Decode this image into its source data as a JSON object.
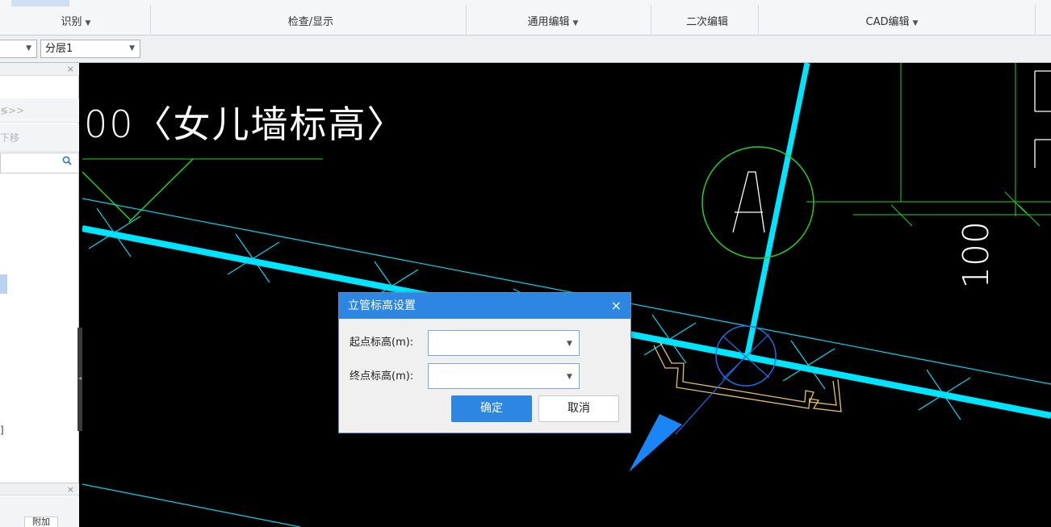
{
  "ribbon": {
    "groups": [
      {
        "label": "识别",
        "has_menu": true
      },
      {
        "label": "检查/显示",
        "has_menu": false
      },
      {
        "label": "通用编辑",
        "has_menu": true
      },
      {
        "label": "二次编辑",
        "has_menu": false
      },
      {
        "label": "CAD编辑",
        "has_menu": true
      }
    ]
  },
  "layer_bar": {
    "floor_combo_value": "",
    "layer_combo_value": "分层1"
  },
  "left_panel": {
    "row1_text": "≶>>",
    "row2_text": "下移",
    "bottom_button": "附加",
    "fragment_text": "]"
  },
  "canvas": {
    "annotation_text": "00〈女儿墙标高〉",
    "axis_label": "A",
    "vertical_dimension": "100"
  },
  "dialog": {
    "title": "立管标高设置",
    "close_glyph": "×",
    "start_label": "起点标高(m):",
    "start_value": "",
    "end_label": "终点标高(m):",
    "end_value": "",
    "ok_label": "确定",
    "cancel_label": "取消"
  },
  "colors": {
    "accent": "#2d86e2",
    "cad_background": "#000000",
    "pipe_cyan": "#00e5ff",
    "cad_green": "#1fd31f",
    "cad_yellow": "#e8c15a",
    "cad_blue": "#1a6ee6"
  },
  "icons": {
    "dropdown": "chevron-down-icon",
    "search": "search-icon",
    "close": "close-icon"
  }
}
